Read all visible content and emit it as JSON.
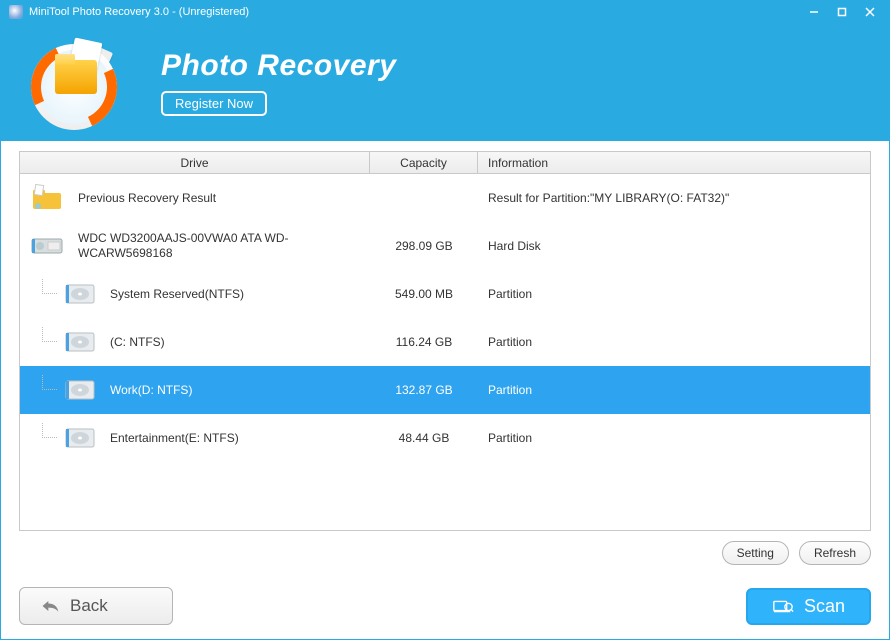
{
  "window": {
    "title": "MiniTool Photo Recovery 3.0 - (Unregistered)"
  },
  "header": {
    "app_name": "Photo Recovery",
    "register_label": "Register Now"
  },
  "columns": {
    "drive": "Drive",
    "capacity": "Capacity",
    "info": "Information"
  },
  "rows": [
    {
      "indent": false,
      "icon": "folder",
      "label": "Previous Recovery Result",
      "capacity": "",
      "info": "Result for Partition:\"MY LIBRARY(O: FAT32)\"",
      "selected": false
    },
    {
      "indent": false,
      "icon": "hdd",
      "label": "WDC WD3200AAJS-00VWA0 ATA WD-WCARW5698168",
      "capacity": "298.09 GB",
      "info": "Hard Disk",
      "selected": false
    },
    {
      "indent": true,
      "icon": "disk",
      "label": "System Reserved(NTFS)",
      "capacity": "549.00 MB",
      "info": "Partition",
      "selected": false
    },
    {
      "indent": true,
      "icon": "disk",
      "label": "(C: NTFS)",
      "capacity": "116.24 GB",
      "info": "Partition",
      "selected": false
    },
    {
      "indent": true,
      "icon": "disk",
      "label": "Work(D: NTFS)",
      "capacity": "132.87 GB",
      "info": "Partition",
      "selected": true
    },
    {
      "indent": true,
      "icon": "disk",
      "label": "Entertainment(E: NTFS)",
      "capacity": "48.44 GB",
      "info": "Partition",
      "selected": false
    }
  ],
  "buttons": {
    "setting": "Setting",
    "refresh": "Refresh",
    "back": "Back",
    "scan": "Scan"
  }
}
